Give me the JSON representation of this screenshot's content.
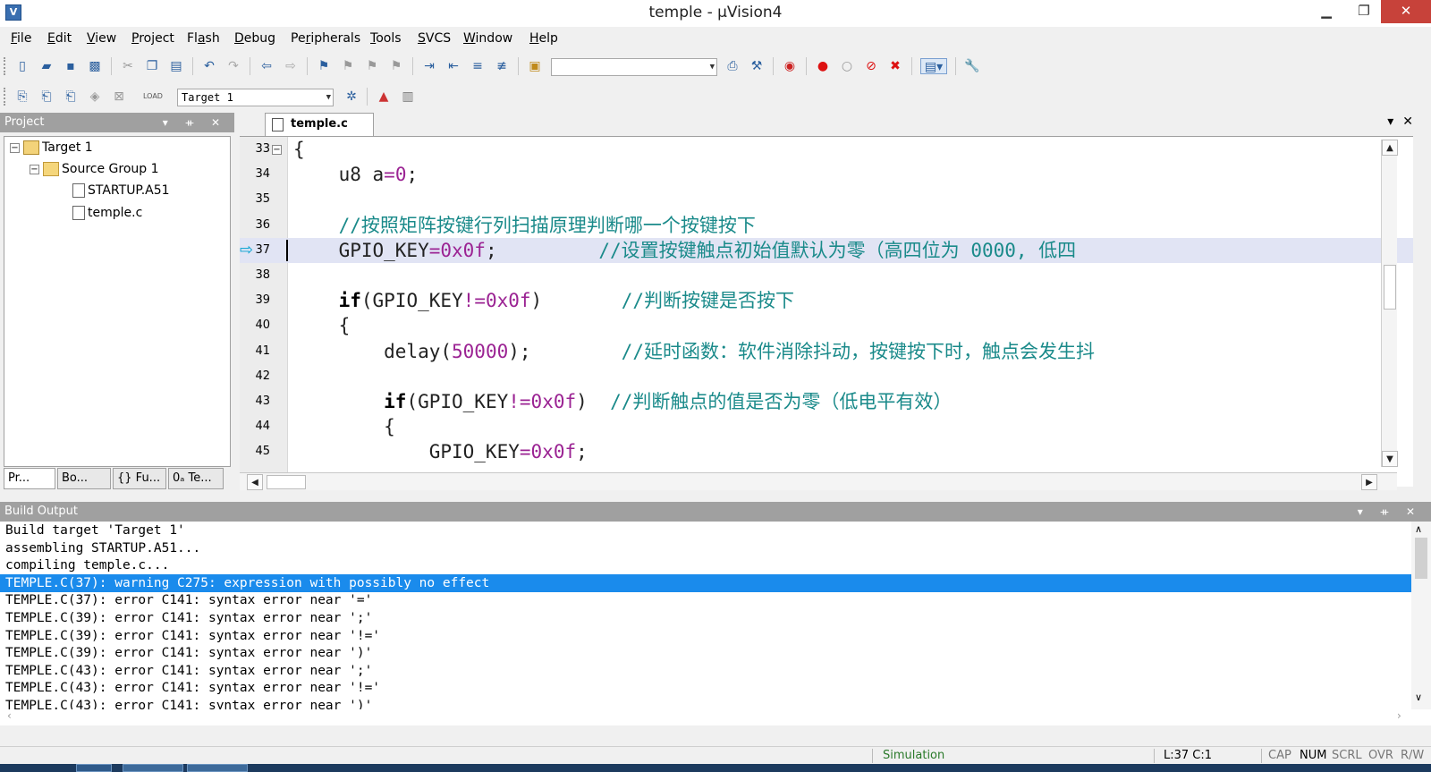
{
  "window": {
    "title": "temple - µVision4",
    "minimize": "▁",
    "maximize": "❐",
    "close": "✕"
  },
  "menu": [
    {
      "pre": "",
      "u": "F",
      "post": "ile"
    },
    {
      "pre": "",
      "u": "E",
      "post": "dit"
    },
    {
      "pre": "",
      "u": "V",
      "post": "iew"
    },
    {
      "pre": "",
      "u": "P",
      "post": "roject"
    },
    {
      "pre": "Fl",
      "u": "a",
      "post": "sh"
    },
    {
      "pre": "",
      "u": "D",
      "post": "ebug"
    },
    {
      "pre": "Pe",
      "u": "r",
      "post": "ipherals"
    },
    {
      "pre": "",
      "u": "T",
      "post": "ools"
    },
    {
      "pre": "",
      "u": "S",
      "post": "VCS"
    },
    {
      "pre": "",
      "u": "W",
      "post": "indow"
    },
    {
      "pre": "",
      "u": "H",
      "post": "elp"
    }
  ],
  "toolbar2": {
    "target_combo": "Target 1"
  },
  "project": {
    "header": "Project",
    "tree": [
      {
        "label": "Target 1",
        "icon": "target-icon",
        "exp": "−"
      },
      {
        "label": "Source Group 1",
        "icon": "folder-icon",
        "exp": "−"
      },
      {
        "label": "STARTUP.A51",
        "icon": "file-icon"
      },
      {
        "label": "temple.c",
        "icon": "file-icon"
      }
    ],
    "tabs": [
      "Pr...",
      "Bo...",
      "{} Fu...",
      "0ₐ Te..."
    ]
  },
  "editor": {
    "tab": "temple.c",
    "current_line": 37,
    "lines": [
      {
        "n": "33",
        "fold": "−",
        "segs": [
          {
            "t": "{",
            "c": "p"
          }
        ]
      },
      {
        "n": "34",
        "segs": [
          {
            "t": "    u8 a",
            "c": "p"
          },
          {
            "t": "=",
            "c": "op"
          },
          {
            "t": "0",
            "c": "num"
          },
          {
            "t": ";",
            "c": "p"
          }
        ]
      },
      {
        "n": "35",
        "segs": []
      },
      {
        "n": "36",
        "segs": [
          {
            "t": "    //按照矩阵按键行列扫描原理判断哪一个按键按下",
            "c": "cm"
          }
        ]
      },
      {
        "n": "37",
        "segs": [
          {
            "t": "    GPIO_KEY",
            "c": "p"
          },
          {
            "t": "=",
            "c": "op"
          },
          {
            "t": "0x0f",
            "c": "num"
          },
          {
            "t": ";         ",
            "c": "p"
          },
          {
            "t": "//设置按键触点初始值默认为零（高四位为 0000, 低四",
            "c": "cm"
          }
        ]
      },
      {
        "n": "38",
        "segs": []
      },
      {
        "n": "39",
        "segs": [
          {
            "t": "    ",
            "c": "p"
          },
          {
            "t": "if",
            "c": "kw"
          },
          {
            "t": "(GPIO_KEY",
            "c": "p"
          },
          {
            "t": "!=",
            "c": "op"
          },
          {
            "t": "0x0f",
            "c": "num"
          },
          {
            "t": ")       ",
            "c": "p"
          },
          {
            "t": "//判断按键是否按下",
            "c": "cm"
          }
        ]
      },
      {
        "n": "40",
        "segs": [
          {
            "t": "    {",
            "c": "p"
          }
        ]
      },
      {
        "n": "41",
        "segs": [
          {
            "t": "        delay(",
            "c": "p"
          },
          {
            "t": "50000",
            "c": "num"
          },
          {
            "t": ");        ",
            "c": "p"
          },
          {
            "t": "//延时函数：软件消除抖动，按键按下时，触点会发生抖",
            "c": "cm"
          }
        ]
      },
      {
        "n": "42",
        "segs": []
      },
      {
        "n": "43",
        "segs": [
          {
            "t": "        ",
            "c": "p"
          },
          {
            "t": "if",
            "c": "kw"
          },
          {
            "t": "(GPIO_KEY",
            "c": "p"
          },
          {
            "t": "!=",
            "c": "op"
          },
          {
            "t": "0x0f",
            "c": "num"
          },
          {
            "t": ")  ",
            "c": "p"
          },
          {
            "t": "//判断触点的值是否为零（低电平有效）",
            "c": "cm"
          }
        ]
      },
      {
        "n": "44",
        "segs": [
          {
            "t": "        {",
            "c": "p"
          }
        ]
      },
      {
        "n": "45",
        "segs": [
          {
            "t": "            GPIO_KEY",
            "c": "p"
          },
          {
            "t": "=",
            "c": "op"
          },
          {
            "t": "0x0f",
            "c": "num"
          },
          {
            "t": ";",
            "c": "p"
          }
        ]
      }
    ]
  },
  "build": {
    "header": "Build Output",
    "selected_index": 3,
    "lines": [
      "Build target 'Target 1'",
      "assembling STARTUP.A51...",
      "compiling temple.c...",
      "TEMPLE.C(37): warning C275: expression with possibly no effect",
      "TEMPLE.C(37): error C141: syntax error near '='",
      "TEMPLE.C(39): error C141: syntax error near ';'",
      "TEMPLE.C(39): error C141: syntax error near '!='",
      "TEMPLE.C(39): error C141: syntax error near ')'",
      "TEMPLE.C(43): error C141: syntax error near ';'",
      "TEMPLE.C(43): error C141: syntax error near '!='",
      "TEMPLE.C(43): error C141: syntax error near ')'"
    ]
  },
  "status": {
    "mode": "Simulation",
    "position": "L:37 C:1",
    "indicators": [
      {
        "label": "CAP",
        "on": false
      },
      {
        "label": "NUM",
        "on": true
      },
      {
        "label": "SCRL",
        "on": false
      },
      {
        "label": "OVR",
        "on": false
      },
      {
        "label": "R/W",
        "on": false
      }
    ]
  },
  "colors": {
    "selection": "#1a8bec",
    "comment": "#1a8a8a",
    "number": "#9b2393",
    "current_line": "#e1e4f4",
    "panel_header": "#a0a0a0"
  }
}
